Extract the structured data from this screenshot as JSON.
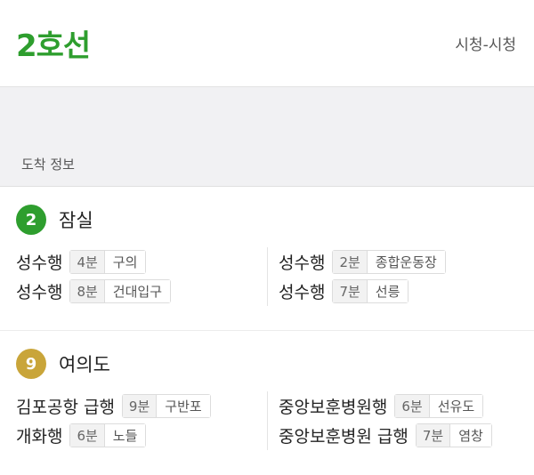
{
  "header": {
    "line_title": "2호선",
    "route": "시청-시청",
    "line_color": "#2e9e2e"
  },
  "section_label": "도착 정보",
  "stations": [
    {
      "badge": "2",
      "badge_color": "#2e9e2e",
      "name": "잠실",
      "left": [
        {
          "dir": "성수행",
          "time": "4분",
          "next": "구의"
        },
        {
          "dir": "성수행",
          "time": "8분",
          "next": "건대입구"
        }
      ],
      "right": [
        {
          "dir": "성수행",
          "time": "2분",
          "next": "종합운동장"
        },
        {
          "dir": "성수행",
          "time": "7분",
          "next": "선릉"
        }
      ]
    },
    {
      "badge": "9",
      "badge_color": "#c9a53a",
      "name": "여의도",
      "left": [
        {
          "dir": "김포공항 급행",
          "time": "9분",
          "next": "구반포"
        },
        {
          "dir": "개화행",
          "time": "6분",
          "next": "노들"
        }
      ],
      "right": [
        {
          "dir": "중앙보훈병원행",
          "time": "6분",
          "next": "선유도"
        },
        {
          "dir": "중앙보훈병원 급행",
          "time": "7분",
          "next": "염창"
        }
      ]
    }
  ]
}
